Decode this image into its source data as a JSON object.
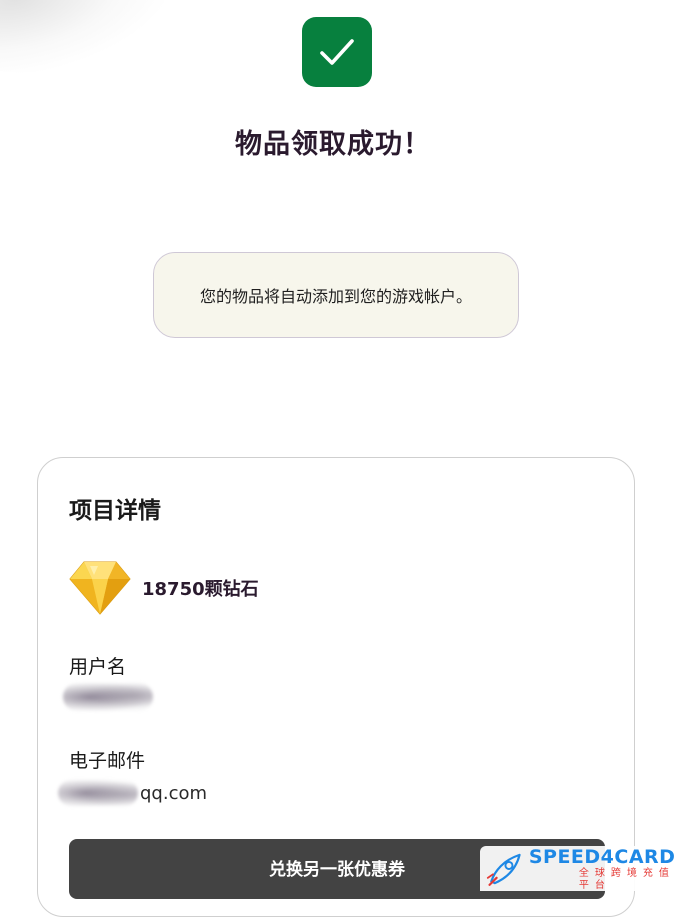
{
  "success": {
    "title": "物品领取成功！",
    "icon": "check-icon",
    "accent_color": "#07803e"
  },
  "notice": {
    "text": "您的物品将自动添加到您的游戏帐户。"
  },
  "details": {
    "heading": "项目详情",
    "item": {
      "name": "18750颗钻石",
      "icon": "diamond-gem-icon"
    },
    "username": {
      "label": "用户名",
      "value_redacted": true
    },
    "email": {
      "label": "电子邮件",
      "visible_part": "qq.com"
    }
  },
  "actions": {
    "redeem_another_label": "兑换另一张优惠券"
  },
  "watermark": {
    "brand": "SPEED4CARD",
    "tagline": "全球跨境充值平台",
    "icon": "rocket-icon"
  }
}
